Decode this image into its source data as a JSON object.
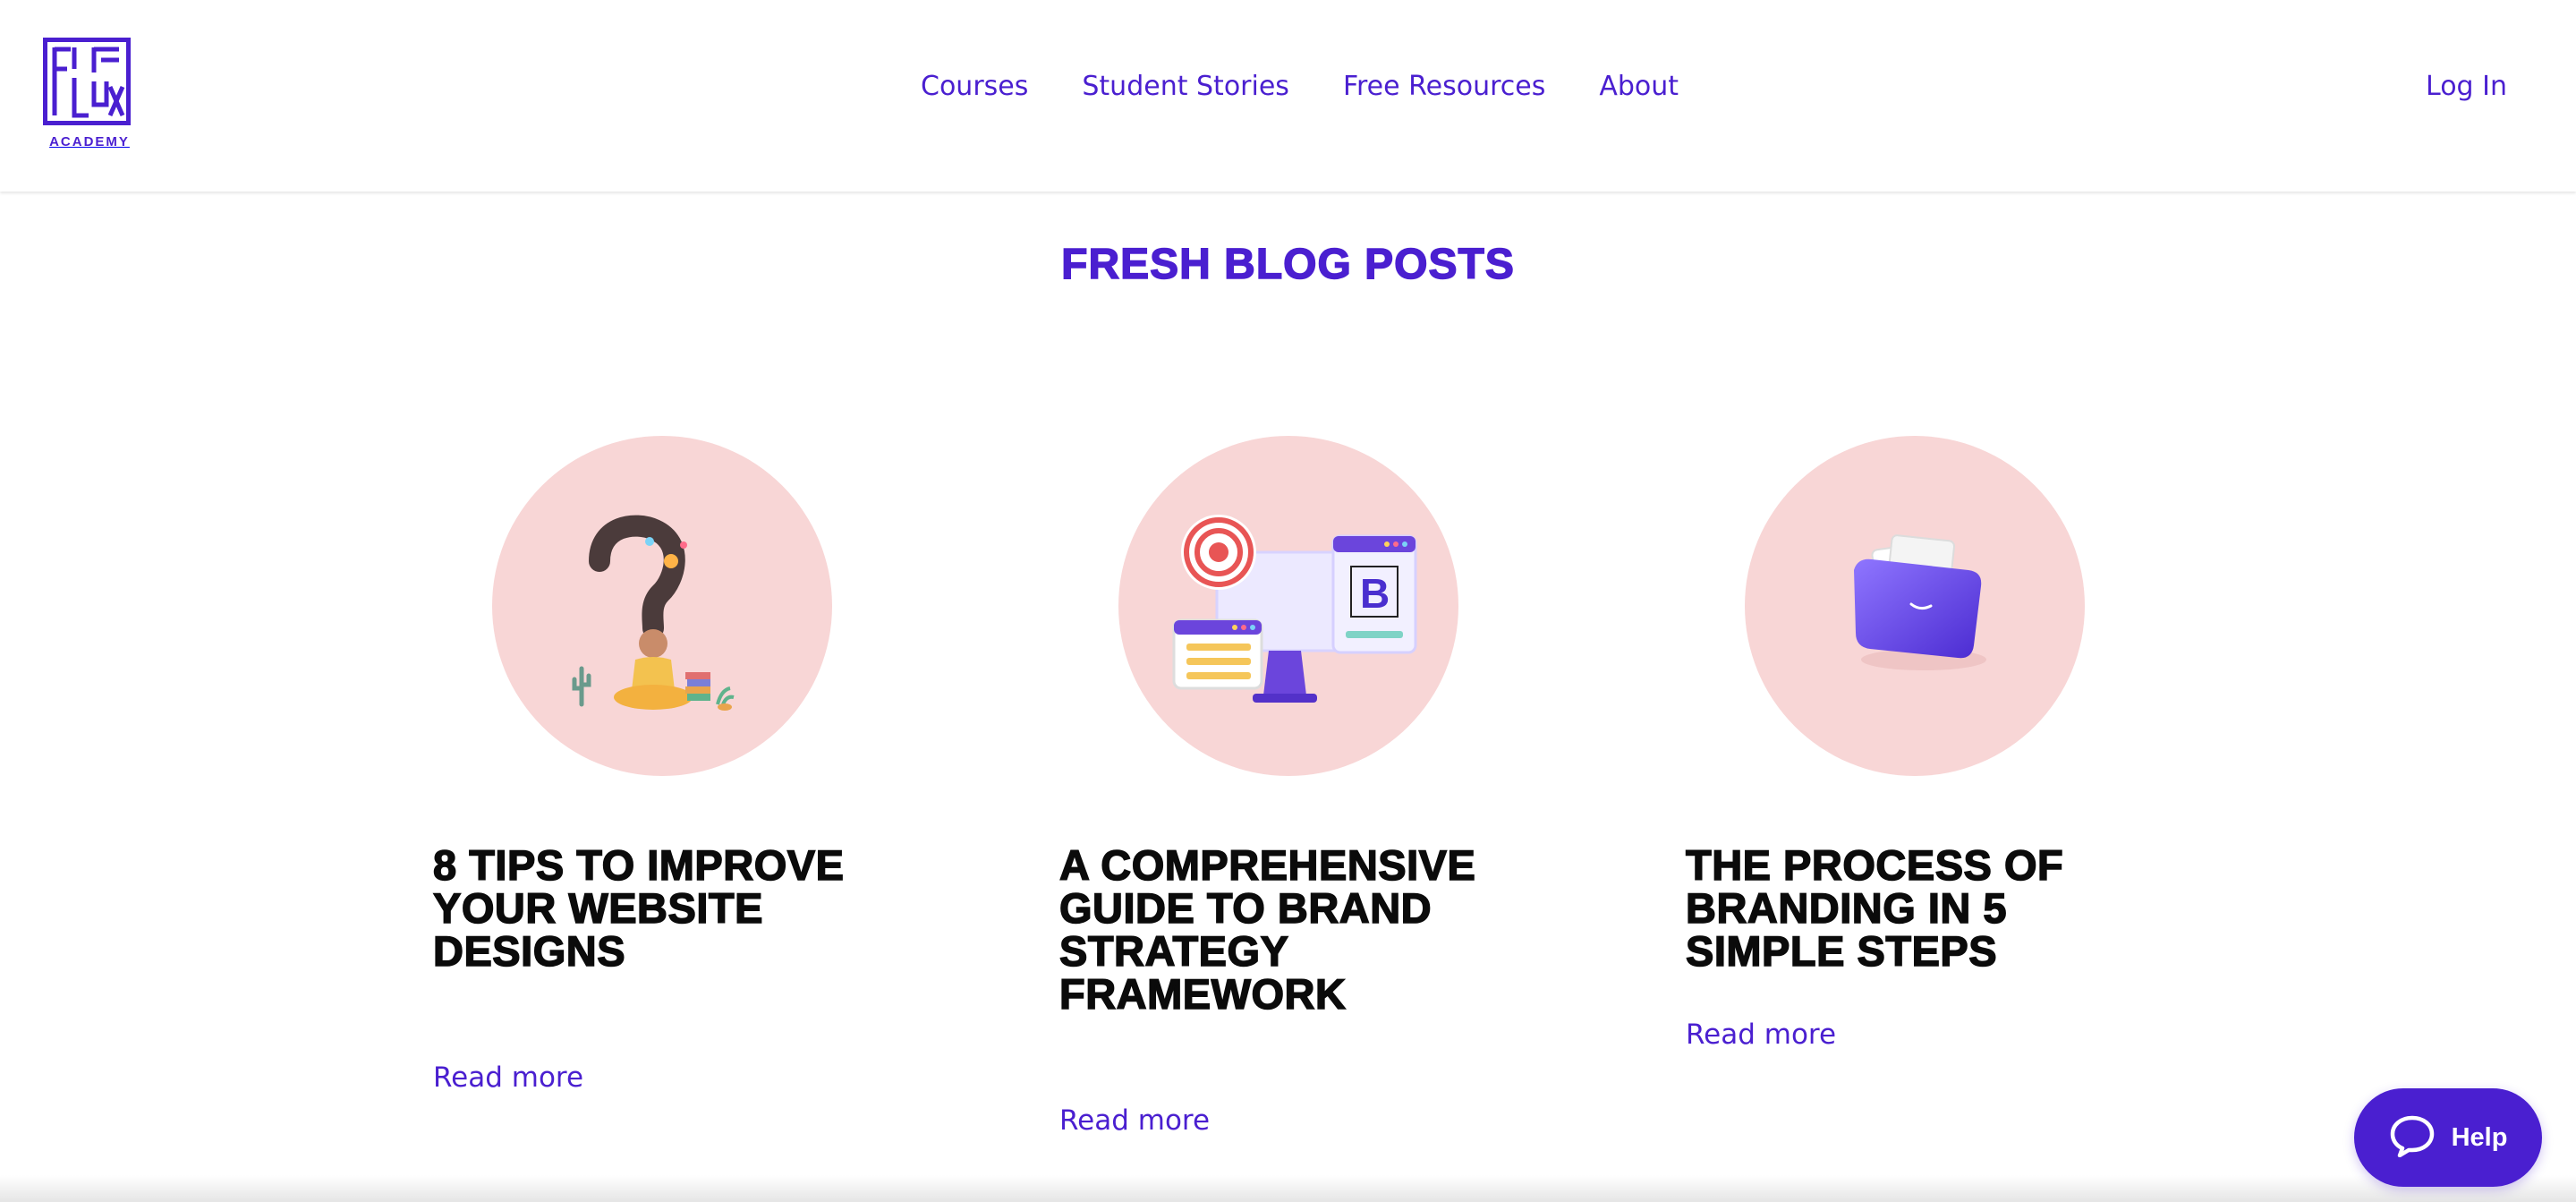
{
  "brand": {
    "logo_word": "FLUX",
    "logo_sub": "ACADEMY",
    "accent": "#4a1fd0",
    "card_bg": "#f8d6d6"
  },
  "nav": {
    "items": [
      "Courses",
      "Student Stories",
      "Free Resources",
      "About"
    ],
    "login": "Log In"
  },
  "section": {
    "title": "FRESH BLOG POSTS"
  },
  "posts": [
    {
      "title": "8 TIPS TO IMPROVE YOUR WEBSITE DESIGNS",
      "link": "Read more",
      "image": "meditating-person-illustration"
    },
    {
      "title": "A COMPREHENSIVE GUIDE TO BRAND STRATEGY FRAMEWORK",
      "link": "Read more",
      "image": "monitor-target-illustration"
    },
    {
      "title": "THE PROCESS OF BRANDING IN 5 SIMPLE STEPS",
      "link": "Read more",
      "image": "purple-folder-illustration"
    }
  ],
  "help": {
    "label": "Help"
  }
}
